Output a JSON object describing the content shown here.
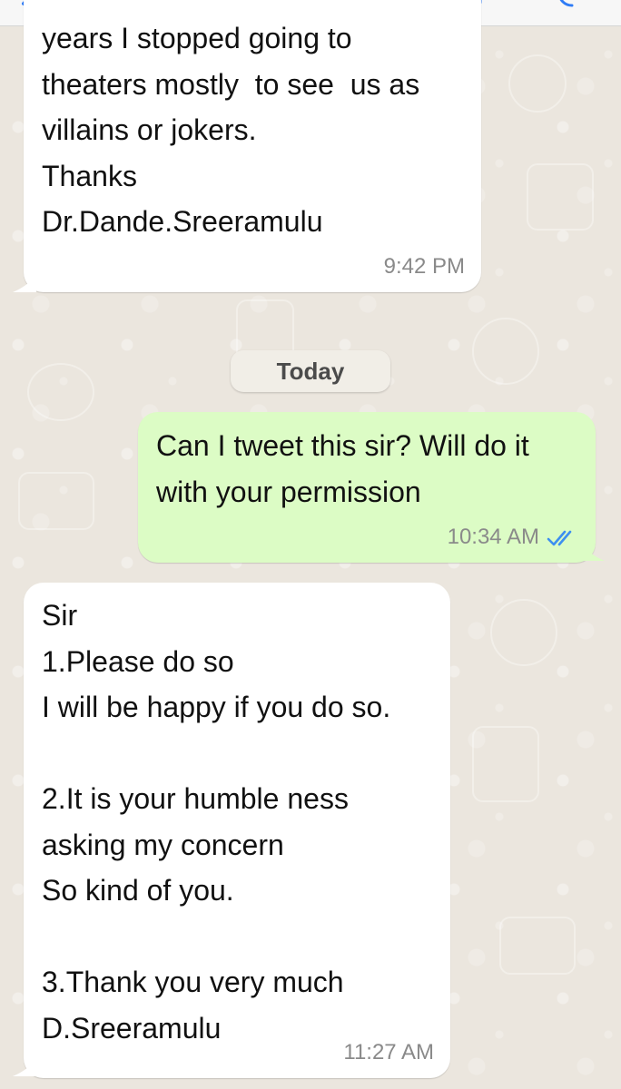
{
  "header": {
    "back_icon": "chevron-left-icon",
    "video_icon": "video-camera-icon",
    "call_icon": "phone-icon"
  },
  "date_divider": "Today",
  "messages": [
    {
      "direction": "incoming",
      "text": "years I stopped going to\ntheaters mostly  to see  us as\nvillains or jokers.\nThanks\nDr.Dande.Sreeramulu",
      "time": "9:42 PM"
    },
    {
      "direction": "outgoing",
      "text": "Can I tweet this sir? Will do it\nwith your permission",
      "time": "10:34 AM",
      "status_icon": "double-check-read-icon"
    },
    {
      "direction": "incoming",
      "text": "Sir\n1.Please do so\nI will be happy if you do so.\n\n2.It is your humble ness\nasking my concern\nSo kind of you.\n\n3.Thank you very much\nD.Sreeramulu",
      "time": "11:27 AM"
    }
  ],
  "colors": {
    "incoming_bubble": "#ffffff",
    "outgoing_bubble": "#dcfcc5",
    "read_ticks": "#3d8ff0",
    "wallpaper": "#ebe6de"
  }
}
